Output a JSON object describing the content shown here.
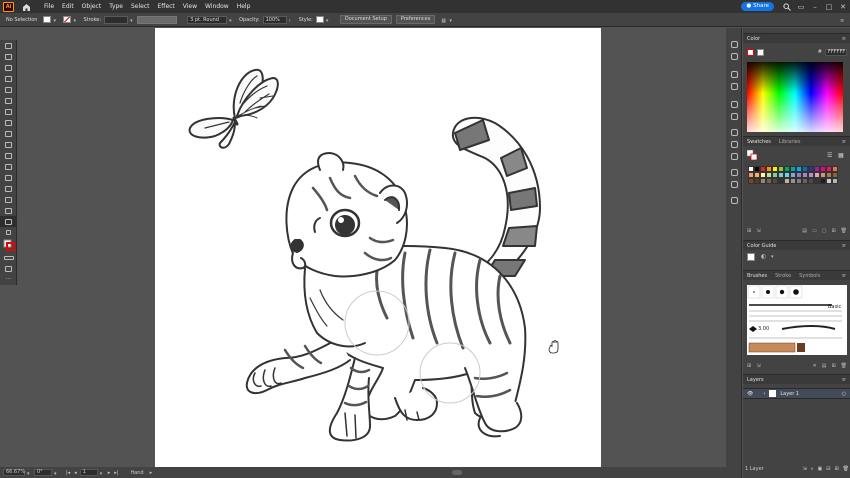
{
  "menubar": {
    "app_logo": "Ai",
    "items": [
      "File",
      "Edit",
      "Object",
      "Type",
      "Select",
      "Effect",
      "View",
      "Window",
      "Help"
    ],
    "share_label": "Share"
  },
  "controlbar": {
    "selection": "No Selection",
    "stroke_label": "Stroke:",
    "brush_value": "3 pt. Round",
    "opacity_label": "Opacity:",
    "opacity_value": "100%",
    "style_label": "Style:",
    "doc_setup_label": "Document Setup",
    "preferences_label": "Preferences"
  },
  "statusbar": {
    "zoom": "66.67%",
    "rotation": "0°",
    "artboard_num": "1",
    "tool_name": "Hand"
  },
  "panels": {
    "color": {
      "title": "Color",
      "hex": "FFFFFF"
    },
    "swatches": {
      "tab": "Swatches",
      "libraries_tab": "Libraries"
    },
    "color_guide": {
      "title": "Color Guide"
    },
    "brushes": {
      "tab": "Brushes",
      "stroke_tab": "Stroke",
      "symbols_tab": "Symbols",
      "basic_label": "Basic",
      "size_label": "3.00"
    },
    "layers": {
      "title": "Layers",
      "layer_name": "Layer 1",
      "count_label": "1 Layer"
    }
  },
  "colors": {
    "swatches": [
      "#ffffff",
      "#000000",
      "#ed1c24",
      "#f7941d",
      "#fff200",
      "#8dc63f",
      "#00a651",
      "#00a99d",
      "#00aeef",
      "#0072bc",
      "#2e3192",
      "#92278f",
      "#ec008c",
      "#ed145b",
      "#f26c4f",
      "#f7977a",
      "#fbaf5d",
      "#fff799",
      "#c4df9b",
      "#82ca9c",
      "#7accc8",
      "#6dcff6",
      "#7ea7d8",
      "#8781bd",
      "#a186be",
      "#bd8cbf",
      "#f49ac1",
      "#c69c6d",
      "#a67c52",
      "#8c6239",
      "#754c24",
      "#603913",
      "#998675",
      "#736357",
      "#534741",
      "#362f2d",
      "#c7b299",
      "#959595",
      "#7d7d7d",
      "#646464",
      "#4b4b4b",
      "#363636",
      "#1d1d1d",
      "#cccccc",
      "#b3b3b3"
    ],
    "accent": "#1473e6"
  }
}
